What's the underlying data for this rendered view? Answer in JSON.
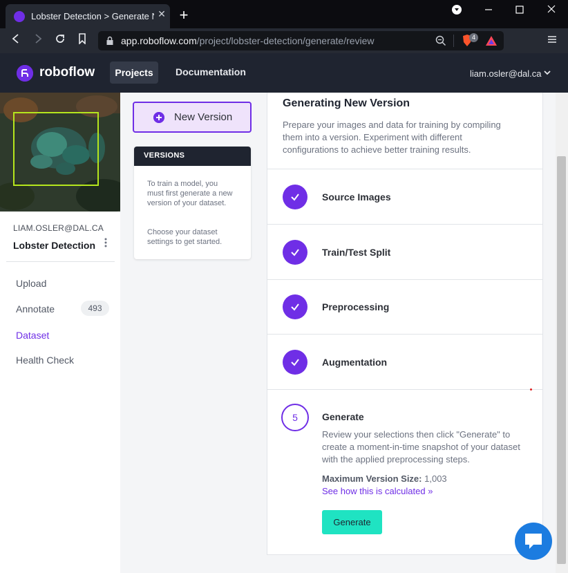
{
  "browser": {
    "tab_title": "Lobster Detection > Generate New",
    "tab_close": "✕",
    "new_tab": "+",
    "url_host": "app.roboflow.com",
    "url_path": "/project/lobster-detection/generate/review",
    "brave_badge_count": "4"
  },
  "header": {
    "logo_text": "roboflow",
    "nav_projects": "Projects",
    "nav_documentation": "Documentation",
    "user_email": "liam.osler@dal.ca"
  },
  "sidebar": {
    "workspace_owner": "LIAM.OSLER@DAL.CA",
    "project_name": "Lobster Detection",
    "nav": [
      {
        "label": "Upload"
      },
      {
        "label": "Annotate",
        "count": "493"
      },
      {
        "label": "Dataset",
        "active": true
      },
      {
        "label": "Health Check"
      }
    ]
  },
  "versions": {
    "new_version_label": "New Version",
    "card_title": "VERSIONS",
    "card_text_1": "To train a model, you must first generate a new version of your dataset.",
    "card_text_2": "Choose your dataset settings to get started."
  },
  "main": {
    "title": "Generating New Version",
    "description": "Prepare your images and data for training by compiling them into a version. Experiment with different configurations to achieve better training results.",
    "steps": [
      {
        "label": "Source Images",
        "status": "complete"
      },
      {
        "label": "Train/Test Split",
        "status": "complete"
      },
      {
        "label": "Preprocessing",
        "status": "complete"
      },
      {
        "label": "Augmentation",
        "status": "complete"
      },
      {
        "label": "Generate",
        "status": "current",
        "number": "5"
      }
    ],
    "generate_description": "Review your selections then click \"Generate\" to create a moment-in-time snapshot of your dataset with the applied preprocessing steps.",
    "max_size_label": "Maximum Version Size:",
    "max_size_value": "1,003",
    "see_how_link": "See how this is calculated »",
    "generate_button": "Generate"
  },
  "colors": {
    "brand_purple": "#6f2ee6",
    "generate_teal": "#1fe3c2",
    "header_dark": "#1f2430",
    "chat_blue": "#1c7ce0"
  },
  "icons": {
    "check": "check-icon",
    "plus": "plus-circle-icon",
    "chat": "chat-icon",
    "chevron": "chevron-down-icon"
  }
}
